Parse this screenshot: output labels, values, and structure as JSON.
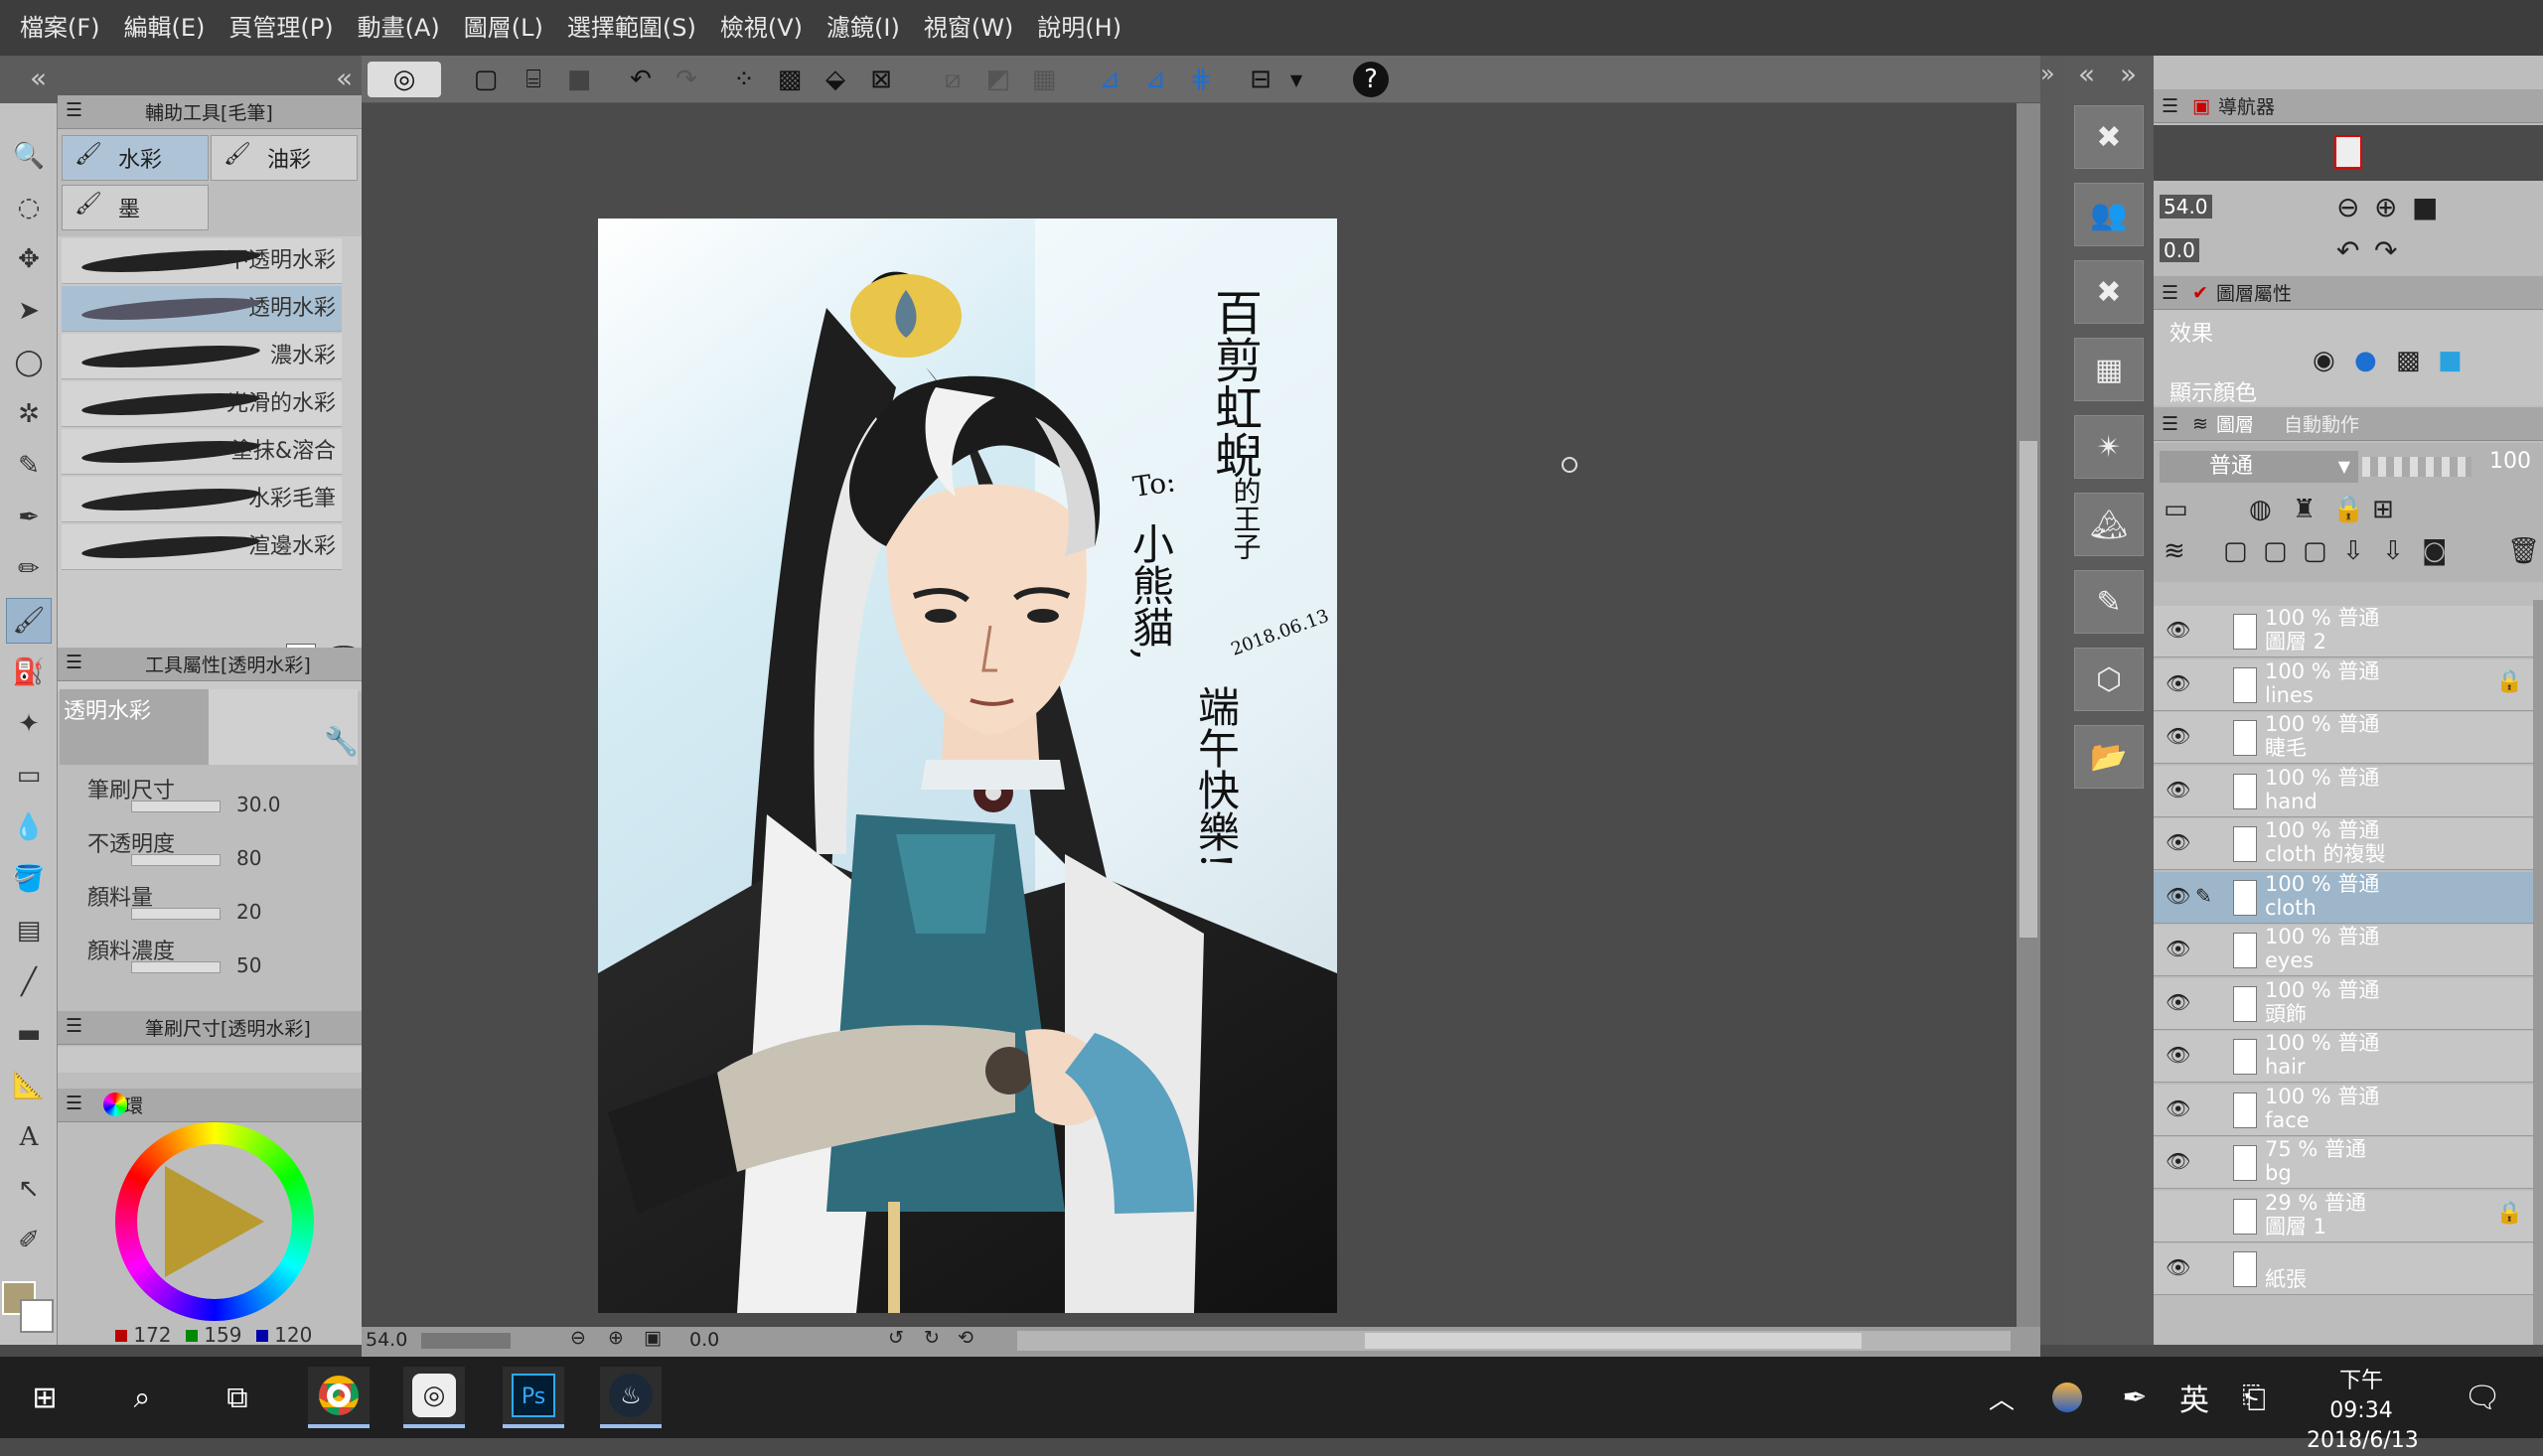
{
  "menu": [
    "檔案(F)",
    "編輯(E)",
    "頁管理(P)",
    "動畫(A)",
    "圖層(L)",
    "選擇範圍(S)",
    "檢視(V)",
    "濾鏡(I)",
    "視窗(W)",
    "說明(H)"
  ],
  "subtool_panel": {
    "title": "輔助工具[毛筆]",
    "tabs": [
      "水彩",
      "油彩",
      "墨"
    ],
    "brushes": [
      "不透明水彩",
      "透明水彩",
      "濃水彩",
      "光滑的水彩",
      "塗抹&溶合",
      "水彩毛筆",
      "渲邊水彩"
    ]
  },
  "tool_property": {
    "title": "工具屬性[透明水彩]",
    "preview_label": "透明水彩",
    "props": [
      {
        "label": "筆刷尺寸",
        "value": "30.0"
      },
      {
        "label": "不透明度",
        "value": "80"
      },
      {
        "label": "顏料量",
        "value": "20"
      },
      {
        "label": "顏料濃度",
        "value": "50"
      }
    ]
  },
  "brush_size_panel": {
    "title": "筆刷尺寸[透明水彩]"
  },
  "color_panel": {
    "title": "色環",
    "r": "172",
    "g": "159",
    "b": "120"
  },
  "status": {
    "zoom": "54.0",
    "rotation": "0.0"
  },
  "navigator": {
    "title": "導航器",
    "zoom": "54.0",
    "rotation": "0.0"
  },
  "layer_property": {
    "title": "圖層屬性",
    "effect": "效果",
    "display_color": "顯示顏色"
  },
  "layer_panel": {
    "title": "圖層",
    "auto_action": "自動動作",
    "blend_mode": "普通",
    "opacity": "100",
    "layers": [
      {
        "line1": "100 % 普通",
        "line2": "圖層 2",
        "locked": false,
        "selected": false
      },
      {
        "line1": "100 % 普通",
        "line2": "lines",
        "locked": true,
        "selected": false
      },
      {
        "line1": "100 % 普通",
        "line2": "睫毛",
        "locked": false,
        "selected": false
      },
      {
        "line1": "100 % 普通",
        "line2": "hand",
        "locked": false,
        "selected": false
      },
      {
        "line1": "100 % 普通",
        "line2": "cloth 的複製",
        "locked": false,
        "selected": false
      },
      {
        "line1": "100 % 普通",
        "line2": "cloth",
        "locked": false,
        "selected": true
      },
      {
        "line1": "100 % 普通",
        "line2": "eyes",
        "locked": false,
        "selected": false
      },
      {
        "line1": "100 % 普通",
        "line2": "頭飾",
        "locked": false,
        "selected": false
      },
      {
        "line1": "100 % 普通",
        "line2": "hair",
        "locked": false,
        "selected": false
      },
      {
        "line1": "100 % 普通",
        "line2": "face",
        "locked": false,
        "selected": false
      },
      {
        "line1": "75 % 普通",
        "line2": "bg",
        "locked": false,
        "selected": false
      },
      {
        "line1": "29 % 普通",
        "line2": "圖層 1",
        "locked": true,
        "selected": false
      },
      {
        "line1": "",
        "line2": "紙張",
        "locked": false,
        "selected": false
      }
    ]
  },
  "artwork_text": {
    "col1": "百剪虹蜺",
    "col1b": "的王子",
    "date1": "2018.06.13",
    "to": "To:",
    "col2": "小熊貓,",
    "col3": "端午快樂!"
  },
  "taskbar": {
    "time_period": "下午 09:34",
    "date": "2018/6/13",
    "ime": "英"
  },
  "colors": {
    "accent": "#9db6ca",
    "menubar": "#3d3d3d",
    "canvas_bg": "#4b4b4b"
  }
}
